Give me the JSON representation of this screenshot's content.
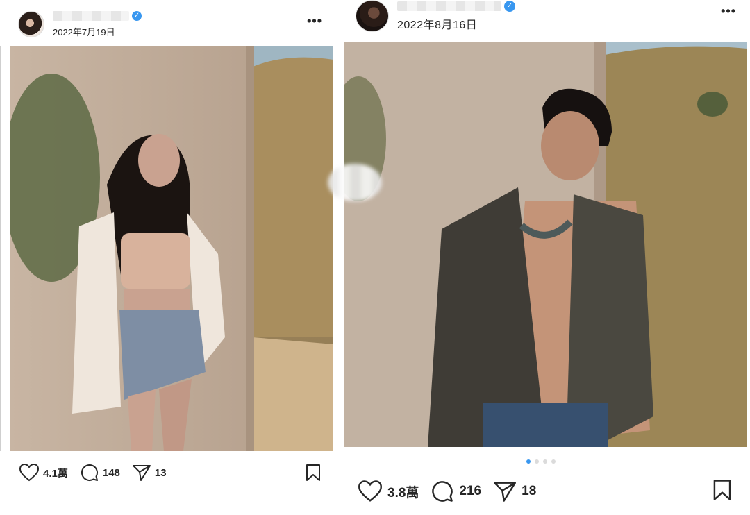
{
  "posts": [
    {
      "date": "2022年7月19日",
      "more_label": "•••",
      "likes": "4.1萬",
      "comments": "148",
      "shares": "13"
    },
    {
      "date": "2022年8月16日",
      "more_label": "•••",
      "likes": "3.8萬",
      "comments": "216",
      "shares": "18",
      "carousel_pages": 4,
      "carousel_active": 1
    }
  ],
  "icons": {
    "like": "heart-icon",
    "comment": "comment-icon",
    "share": "paper-plane-icon",
    "save": "bookmark-icon",
    "verified": "verified-badge-icon"
  },
  "colors": {
    "verified": "#3897f0",
    "text": "#262626",
    "carousel_active": "#3897f0",
    "carousel_inactive": "#dbdbdb"
  }
}
